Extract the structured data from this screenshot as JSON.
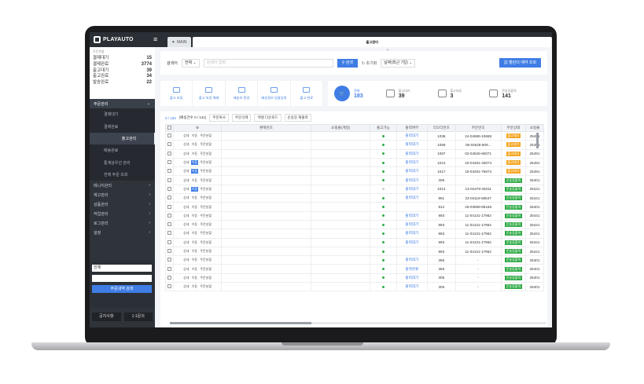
{
  "app": {
    "logo_text": "PLAYAUTO"
  },
  "tabs": [
    {
      "label": "MAIN"
    },
    {
      "label": "출고관리"
    }
  ],
  "sidebar": {
    "stats_caption": "주문현황",
    "stats": [
      {
        "label": "결제대기",
        "value": "15"
      },
      {
        "label": "결제완료",
        "value": "3774"
      },
      {
        "label": "출고대기",
        "value": "39"
      },
      {
        "label": "출고완료",
        "value": "34"
      },
      {
        "label": "발송완료",
        "value": "22"
      }
    ],
    "menu": [
      {
        "label": "주문관리",
        "open": true,
        "subs": [
          "결제대기",
          "결제완료",
          "출고관리",
          "배송완료",
          "통계상우선 관리",
          "전체 주문 조회"
        ]
      },
      {
        "label": "테니지관리"
      },
      {
        "label": "재고관리"
      },
      {
        "label": "상품관리"
      },
      {
        "label": "작업관리"
      },
      {
        "label": "로그관리"
      },
      {
        "label": "설정"
      }
    ],
    "search_select": "전체",
    "search_button": "주문내역 검색",
    "footer_left": "공지사항",
    "footer_right": "1:1문의"
  },
  "search": {
    "label": "검색어",
    "scope": "전체",
    "placeholder": "검색어 입력",
    "button": "검색",
    "reset": "초기화",
    "date_range": "날짜(최근 7일)",
    "calendar_button": "캘린더 예약 조회"
  },
  "actions": [
    {
      "label": "출고 보류"
    },
    {
      "label": "출고 보류 해제"
    },
    {
      "label": "배송처 변경"
    },
    {
      "label": "배송정보 일괄입력"
    },
    {
      "label": "출고 완료"
    }
  ],
  "counts": [
    {
      "label": "전체",
      "value": "183"
    },
    {
      "label": "출고대기",
      "value": "39"
    },
    {
      "label": "출고보류",
      "value": "3"
    },
    {
      "label": "운송장출력",
      "value": "141"
    }
  ],
  "toolbar": {
    "count_text": "0 / 183",
    "count_sub": "(배송건수 0 / 141)",
    "buttons": [
      "주문복사",
      "주문삭제",
      "엑셀 다운로드",
      "운송장 재출력"
    ]
  },
  "table": {
    "headers": [
      "",
      "",
      "",
      "",
      "상품명(옵션)",
      "출고가능",
      "출력여부",
      "리오더번호",
      "주문번호",
      "주문상태",
      "쇼핑몰"
    ],
    "header_labels": {
      "opt": "⚙",
      "name": "판매번호",
      "shop": "쇼핑몰(계정)"
    },
    "row_labels": {
      "detail": "상세",
      "edit": "이동",
      "memo": "주문분할"
    },
    "rows": [
      {
        "reorder": "1036",
        "order": "24-04969-10688",
        "print": "출력대기",
        "status": "출고대기",
        "status_color": "o",
        "mall": "25491",
        "ready": "g"
      },
      {
        "reorder": "1059",
        "order": "06-04628-609...",
        "print": "출력대기",
        "status": "출고대기",
        "status_color": "o",
        "mall": "25491",
        "ready": "g"
      },
      {
        "reorder": "1067",
        "order": "02-04625-60071",
        "print": "출력대기",
        "status": "출고대기",
        "status_color": "o",
        "mall": "25491",
        "ready": "g"
      },
      {
        "reorder": "1013",
        "order": "20-04491-33074",
        "print": "출력대기",
        "status": "출고대기",
        "status_color": "o",
        "mall": "25491",
        "ready": "g"
      },
      {
        "reorder": "1017",
        "order": "18-04491-75673",
        "print": "출력대기",
        "status": "출고대기",
        "status_color": "o",
        "mall": "25491",
        "ready": "g"
      },
      {
        "reorder": "306",
        "order": "-",
        "print": "출력대기",
        "status": "운송장출력",
        "status_color": "g",
        "mall": "25401",
        "ready": "g"
      },
      {
        "reorder": "1014",
        "order": "13-04479-46311",
        "print": "출력대기",
        "status": "운송장출력",
        "status_color": "g",
        "mall": "25441",
        "ready": "grey"
      },
      {
        "reorder": "991",
        "order": "23-04119-56547",
        "print": "출력대기",
        "status": "운송장출력",
        "status_color": "g",
        "mall": "25441",
        "ready": "g"
      },
      {
        "reorder": "812",
        "order": "26-03969-85158",
        "print": "",
        "status": "운송장출력",
        "status_color": "g",
        "mall": "25401",
        "ready": "g"
      },
      {
        "reorder": "993",
        "order": "11-04131-17962",
        "print": "출력대기",
        "status": "운송장출력",
        "status_color": "g",
        "mall": "25441",
        "ready": "g"
      },
      {
        "reorder": "993",
        "order": "11-04131-17962",
        "print": "출력대기",
        "status": "운송장출력",
        "status_color": "g",
        "mall": "25441",
        "ready": "g"
      },
      {
        "reorder": "993",
        "order": "11-04131-17962",
        "print": "출력대기",
        "status": "운송장출력",
        "status_color": "g",
        "mall": "25441",
        "ready": "g"
      },
      {
        "reorder": "993",
        "order": "11-04131-17962",
        "print": "출력대기",
        "status": "운송장출력",
        "status_color": "g",
        "mall": "25441",
        "ready": "g"
      },
      {
        "reorder": "993",
        "order": "11-04131-17962",
        "print": "",
        "status": "운송장출력",
        "status_color": "g",
        "mall": "25441",
        "ready": "g"
      },
      {
        "reorder": "366",
        "order": "-",
        "print": "출력대기",
        "status": "운송장출력",
        "status_color": "g",
        "mall": "25401",
        "ready": "g"
      },
      {
        "reorder": "366",
        "order": "-",
        "print": "출력완료",
        "status": "운송장출력",
        "status_color": "g",
        "mall": "25401",
        "ready": "g"
      },
      {
        "reorder": "305",
        "order": "-",
        "print": "출력대기",
        "status": "운송장출력",
        "status_color": "g",
        "mall": "25401",
        "ready": "g"
      },
      {
        "reorder": "306",
        "order": "-",
        "print": "출력대기",
        "status": "운송장출력",
        "status_color": "g",
        "mall": "25401",
        "ready": "g"
      }
    ]
  }
}
